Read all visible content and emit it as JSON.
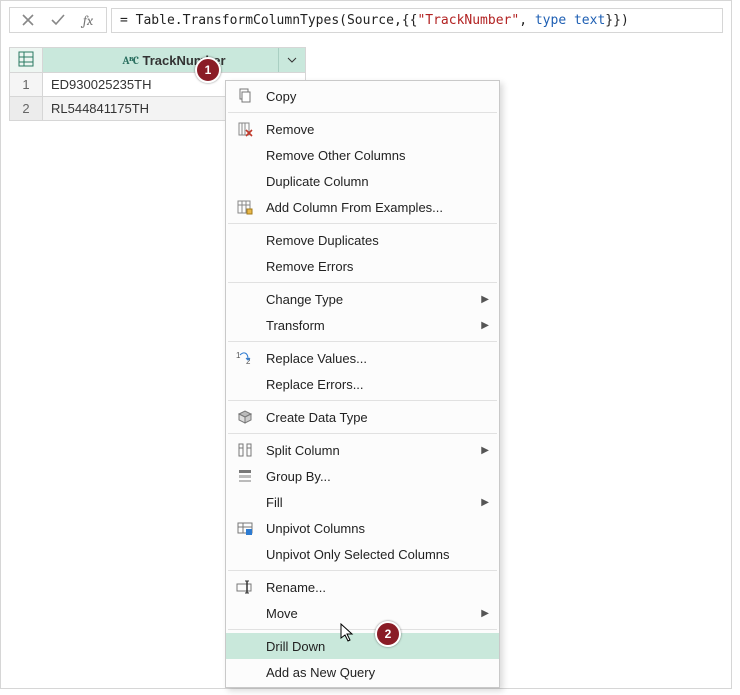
{
  "formula_bar": {
    "eq": "= ",
    "fn": "Table.TransformColumnTypes",
    "open": "(Source,{{",
    "str": "\"TrackNumber\"",
    "mid": ", ",
    "kw1": "type",
    "sp": " ",
    "kw2": "text",
    "close": "}})"
  },
  "table": {
    "column": {
      "type_label": "AᴮC",
      "name": "TrackNumber"
    },
    "rows": [
      {
        "n": "1",
        "val": "ED930025235TH"
      },
      {
        "n": "2",
        "val": "RL544841175TH"
      }
    ]
  },
  "menu": {
    "copy": "Copy",
    "remove": "Remove",
    "remove_other": "Remove Other Columns",
    "duplicate": "Duplicate Column",
    "add_from_examples": "Add Column From Examples...",
    "remove_dup": "Remove Duplicates",
    "remove_err": "Remove Errors",
    "change_type": "Change Type",
    "transform": "Transform",
    "replace_values": "Replace Values...",
    "replace_errors": "Replace Errors...",
    "create_data_type": "Create Data Type",
    "split_column": "Split Column",
    "group_by": "Group By...",
    "fill": "Fill",
    "unpivot": "Unpivot Columns",
    "unpivot_only": "Unpivot Only Selected Columns",
    "rename": "Rename...",
    "move": "Move",
    "drill_down": "Drill Down",
    "add_new_query": "Add as New Query"
  },
  "badges": {
    "one": "1",
    "two": "2"
  }
}
